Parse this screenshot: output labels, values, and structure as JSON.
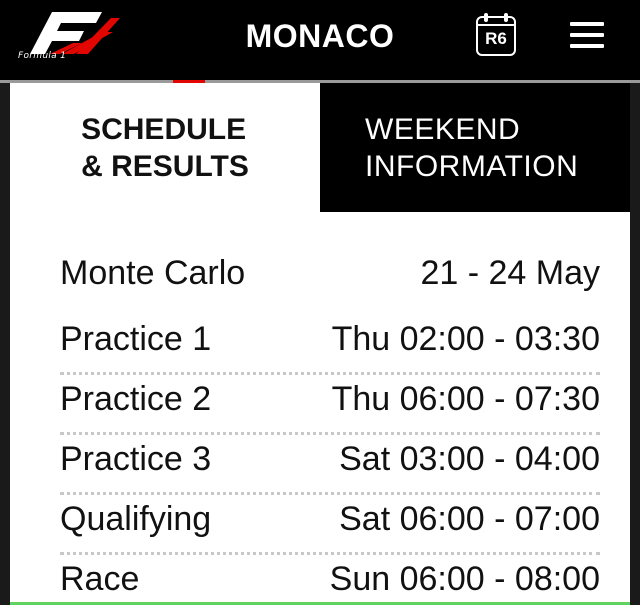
{
  "header": {
    "brand_sub": "Formula 1",
    "title": "MONACO",
    "round_badge": "R6",
    "menu_icon": "hamburger-menu-icon",
    "logo_icon": "formula-1-logo",
    "calendar_icon": "calendar-icon"
  },
  "tabs": [
    {
      "line1": "SCHEDULE",
      "line2": "& RESULTS",
      "active": true
    },
    {
      "line1": "WEEKEND",
      "line2": "INFORMATION",
      "active": false
    }
  ],
  "event": {
    "location": "Monte Carlo",
    "dates": "21 - 24 May"
  },
  "sessions": [
    {
      "name": "Practice 1",
      "time": "Thu 02:00 - 03:30"
    },
    {
      "name": "Practice 2",
      "time": "Thu 06:00 - 07:30"
    },
    {
      "name": "Practice 3",
      "time": "Sat 03:00 - 04:00"
    },
    {
      "name": "Qualifying",
      "time": "Sat 06:00 - 07:00"
    },
    {
      "name": "Race",
      "time": "Sun 06:00 - 08:00"
    }
  ],
  "colors": {
    "accent_red": "#e10600",
    "header_bg": "#000000",
    "panel_bg": "#ffffff"
  }
}
